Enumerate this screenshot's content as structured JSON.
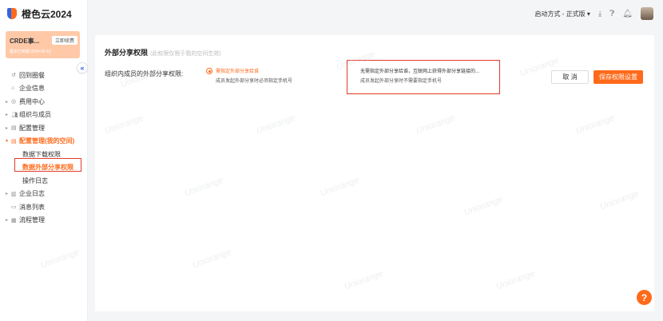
{
  "app": {
    "name": "橙色云2024"
  },
  "workspace": {
    "title": "CRDE事...",
    "action": "立即续费",
    "subtitle": "版本已到期  2024-05-15"
  },
  "sidebar": {
    "items": [
      {
        "label": "回到圈餐",
        "icon": "undo-icon",
        "caret": ""
      },
      {
        "label": "企业信息",
        "icon": "home-icon",
        "caret": ""
      },
      {
        "label": "费用中心",
        "icon": "coin-icon",
        "caret": "▸"
      },
      {
        "label": "组织与成员",
        "icon": "users-icon",
        "caret": "▸"
      },
      {
        "label": "配置管理",
        "icon": "grid-icon",
        "caret": "▸"
      },
      {
        "label": "配置管理(我的空间)",
        "icon": "grid-icon",
        "caret": "▾",
        "active": true
      },
      {
        "label": "企业日志",
        "icon": "chart-icon",
        "caret": "▸"
      },
      {
        "label": "消息列表",
        "icon": "message-icon",
        "caret": ""
      },
      {
        "label": "流程管理",
        "icon": "flow-icon",
        "caret": "▸"
      }
    ],
    "sub_items": [
      "数据下载权限",
      "数据外部分享权限",
      "操作日志"
    ]
  },
  "topbar": {
    "launch_mode": "启动方式 - 正式版 ▾"
  },
  "content": {
    "title": "外部分享权限",
    "note": "(此权限仅限于我的空间生效)",
    "row_label": "组织内成员的外部分享权限:",
    "option1": {
      "main": "需指定外部分享给谁",
      "sub": "成员发起外部分享时必须指定手机号",
      "selected": true
    },
    "option2": {
      "main": "无需指定外部分享给谁，互联网上获得外部分享链接的...",
      "sub": "成员发起外部分享时不需要指定手机号",
      "selected": false
    },
    "cancel_label": "取 消",
    "save_label": "保存权限设置"
  },
  "help": {
    "label": "?"
  },
  "watermark": "Uniorange",
  "colors": {
    "accent": "#ff6a1a",
    "brand_blue": "#2f63e8",
    "highlight_red": "#e23b2b"
  }
}
